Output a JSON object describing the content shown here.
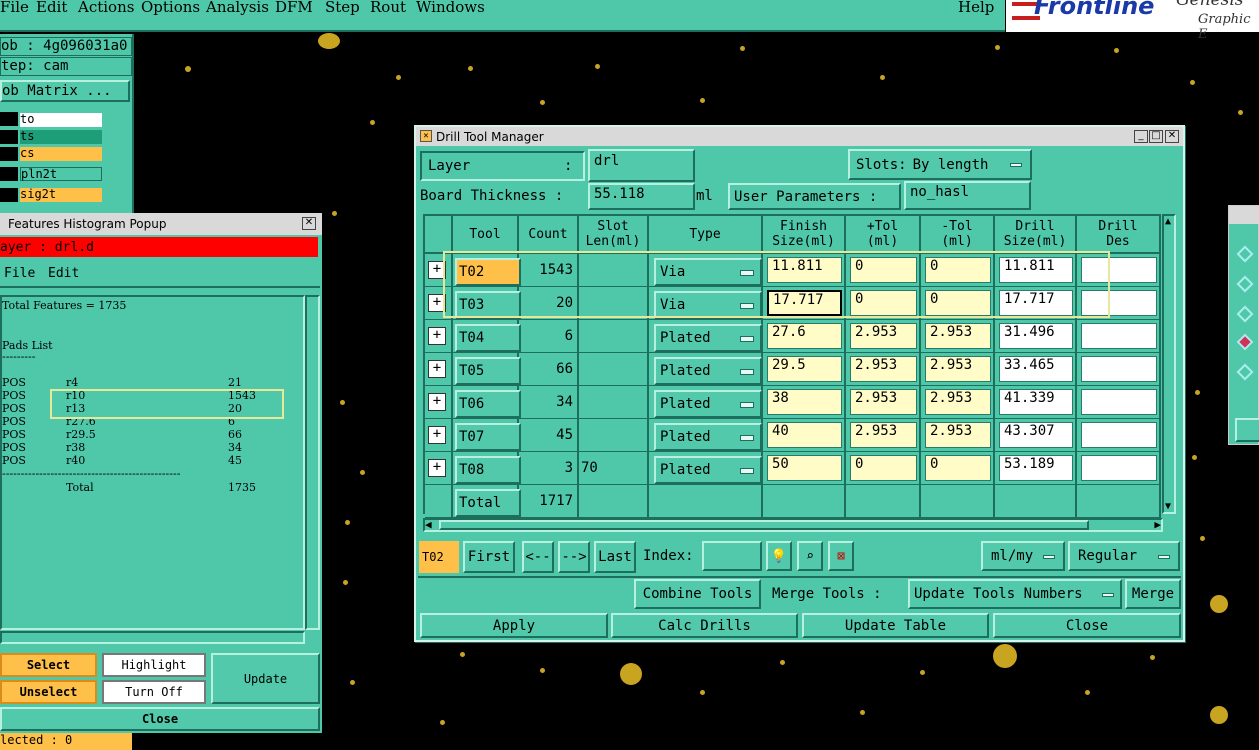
{
  "menubar": {
    "items": [
      "File",
      "Edit",
      "Actions",
      "Options",
      "Analysis",
      "DFM",
      "Step",
      "Rout",
      "Windows"
    ],
    "help": "Help"
  },
  "logo": {
    "brand": "Frontline",
    "line1": "Genesis",
    "line2": "Graphic E"
  },
  "left_panel": {
    "job": "ob : 4g096031a0",
    "step": "tep: cam",
    "matrix_button": "ob Matrix ...",
    "layers": [
      {
        "name": "to",
        "color": "#ffffff"
      },
      {
        "name": "ts",
        "color": "#1d9e78"
      },
      {
        "name": "cs",
        "color": "#ffc04a"
      },
      {
        "name": "pln2t",
        "color": "#4fc8a9"
      },
      {
        "name": "sig2t",
        "color": "#ffc04a"
      }
    ],
    "selected": "lected : 0"
  },
  "histogram": {
    "title": "Features Histogram Popup",
    "layer": "ayer :  drl.d",
    "menu": [
      "File",
      "Edit"
    ],
    "total_features": "Total Features = 1735",
    "pads_list": "Pads List",
    "dash": "---------",
    "rows": [
      [
        "POS",
        "r4",
        "21"
      ],
      [
        "POS",
        "r10",
        "1543"
      ],
      [
        "POS",
        "r13",
        "20"
      ],
      [
        "POS",
        "r27.6",
        "6"
      ],
      [
        "POS",
        "r29.5",
        "66"
      ],
      [
        "POS",
        "r38",
        "34"
      ],
      [
        "POS",
        "r40",
        "45"
      ]
    ],
    "sep": "------------------------------------------------",
    "total_label": "Total",
    "total_value": "1735",
    "buttons": {
      "select": "Select",
      "highlight": "Highlight",
      "update": "Update",
      "unselect": "Unselect",
      "turn_off": "Turn Off",
      "close": "Close"
    }
  },
  "dtm": {
    "title": "Drill Tool Manager",
    "layer_label": "Layer",
    "layer_colon": ":",
    "layer_value": "drl",
    "slots_label": "Slots:",
    "slots_value": "By length",
    "board_thickness_label": "Board Thickness :",
    "board_thickness_value": "55.118",
    "board_thickness_unit": "ml",
    "user_params_label": "User Parameters :",
    "user_params_value": "no_hasl",
    "columns": {
      "tool": "Tool",
      "count": "Count",
      "slot1": "Slot",
      "slot2": "Len(ml)",
      "type": "Type",
      "finish1": "Finish",
      "finish2": "Size(ml)",
      "ptol1": "+Tol",
      "ptol2": "(ml)",
      "ntol1": "-Tol",
      "ntol2": "(ml)",
      "drill1": "Drill",
      "drill2": "Size(ml)",
      "des1": "Drill",
      "des2": "Des"
    },
    "rows": [
      {
        "tool": "T02",
        "count": "1543",
        "slot": "",
        "type": "Via",
        "finish": "11.811",
        "ptol": "0",
        "ntol": "0",
        "drill": "11.811",
        "des": ""
      },
      {
        "tool": "T03",
        "count": "20",
        "slot": "",
        "type": "Via",
        "finish": "17.717",
        "ptol": "0",
        "ntol": "0",
        "drill": "17.717",
        "des": ""
      },
      {
        "tool": "T04",
        "count": "6",
        "slot": "",
        "type": "Plated",
        "finish": "27.6",
        "ptol": "2.953",
        "ntol": "2.953",
        "drill": "31.496",
        "des": ""
      },
      {
        "tool": "T05",
        "count": "66",
        "slot": "",
        "type": "Plated",
        "finish": "29.5",
        "ptol": "2.953",
        "ntol": "2.953",
        "drill": "33.465",
        "des": ""
      },
      {
        "tool": "T06",
        "count": "34",
        "slot": "",
        "type": "Plated",
        "finish": "38",
        "ptol": "2.953",
        "ntol": "2.953",
        "drill": "41.339",
        "des": ""
      },
      {
        "tool": "T07",
        "count": "45",
        "slot": "",
        "type": "Plated",
        "finish": "40",
        "ptol": "2.953",
        "ntol": "2.953",
        "drill": "43.307",
        "des": ""
      },
      {
        "tool": "T08",
        "count": "3",
        "slot": "70",
        "type": "Plated",
        "finish": "50",
        "ptol": "0",
        "ntol": "0",
        "drill": "53.189",
        "des": ""
      }
    ],
    "total_label": "Total",
    "total_count": "1717",
    "nav": {
      "current": "T02",
      "first": "First",
      "prev": "<--",
      "next": "-->",
      "last": "Last",
      "index_label": "Index:",
      "units": "ml/my",
      "mode": "Regular"
    },
    "actions": {
      "combine": "Combine Tools",
      "merge_label": "Merge Tools :",
      "merge_option": "Update Tools Numbers",
      "merge": "Merge"
    },
    "bottom": {
      "apply": "Apply",
      "calc": "Calc Drills",
      "update": "Update Table",
      "close": "Close"
    }
  }
}
